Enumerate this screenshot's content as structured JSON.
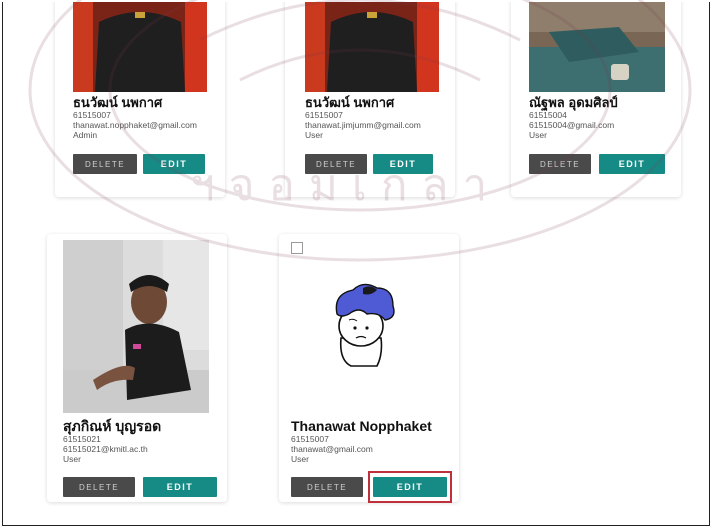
{
  "colors": {
    "edit_button": "#168b86",
    "delete_button": "#4a4a4a",
    "highlight": "#c0303a"
  },
  "cards": [
    {
      "name": "ธนวัฒน์ นพกาศ",
      "id": "61515007",
      "email": "thanawat.nopphaket@gmail.com",
      "role": "Admin",
      "delete_label": "DELETE",
      "edit_label": "EDIT"
    },
    {
      "name": "ธนวัฒน์ นพกาศ",
      "id": "61515007",
      "email": "thanawat.jimjumm@gmail.com",
      "role": "User",
      "delete_label": "DELETE",
      "edit_label": "EDIT"
    },
    {
      "name": "ณัฐพล อุดมศิลป์",
      "id": "61515004",
      "email": "61515004@gmail.com",
      "role": "User",
      "delete_label": "DELETE",
      "edit_label": "EDIT"
    },
    {
      "name": "สุภกิณห์ บุญรอด",
      "id": "61515021",
      "email": "61515021@kmitl.ac.th",
      "role": "User",
      "delete_label": "DELETE",
      "edit_label": "EDIT"
    },
    {
      "name": "Thanawat Nopphaket",
      "id": "61515007",
      "email": "thanawat@gmail.com",
      "role": "User",
      "delete_label": "DELETE",
      "edit_label": "EDIT"
    }
  ]
}
